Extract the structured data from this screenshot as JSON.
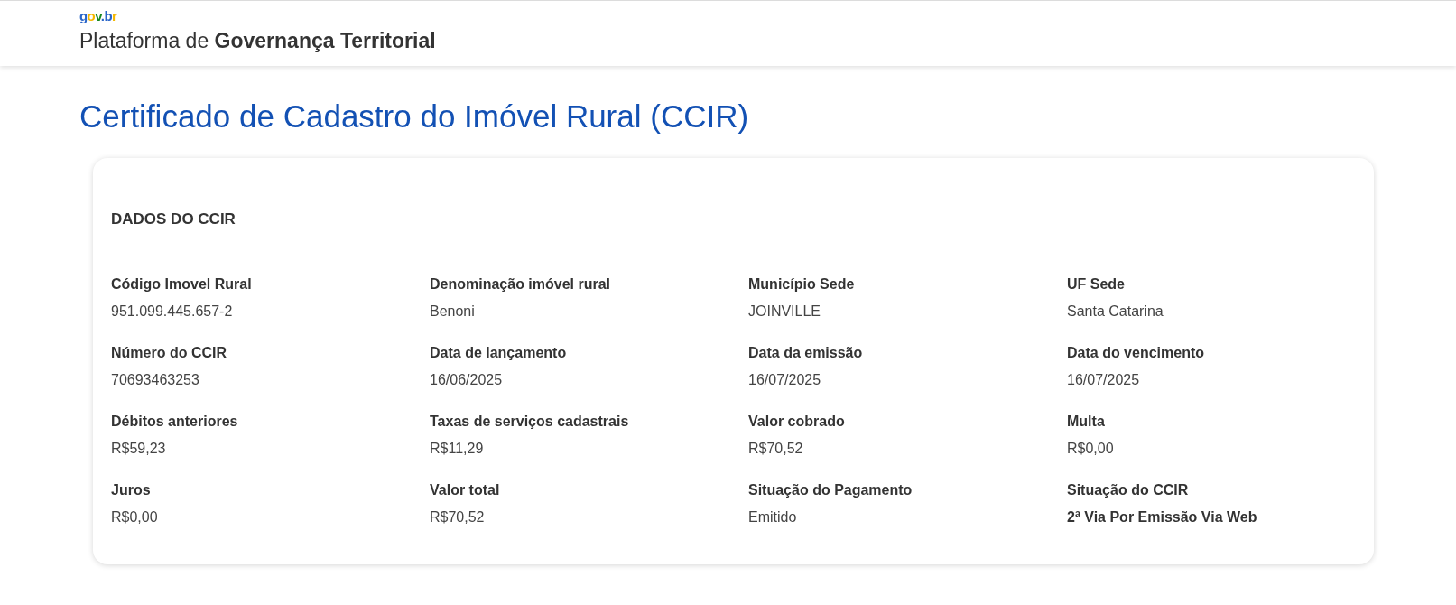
{
  "header": {
    "logo": "gov.br",
    "title": "Plataforma de **Governança Territorial**"
  },
  "page_title": "Certificado de Cadastro do Imóvel Rural (CCIR)",
  "card": {
    "title": "DADOS DO CCIR",
    "fields": [
      {
        "label": "Código Imovel Rural",
        "value": "951.099.445.657-2",
        "strong": false
      },
      {
        "label": "Denominação imóvel rural",
        "value": "Benoni",
        "strong": false
      },
      {
        "label": "Município Sede",
        "value": "JOINVILLE",
        "strong": false
      },
      {
        "label": "UF Sede",
        "value": "Santa Catarina",
        "strong": false
      },
      {
        "label": "Número do CCIR",
        "value": "70693463253",
        "strong": false
      },
      {
        "label": "Data de lançamento",
        "value": "16/06/2025",
        "strong": false
      },
      {
        "label": "Data da emissão",
        "value": "16/07/2025",
        "strong": false
      },
      {
        "label": "Data do vencimento",
        "value": "16/07/2025",
        "strong": false
      },
      {
        "label": "Débitos anteriores",
        "value": "R$59,23",
        "strong": false
      },
      {
        "label": "Taxas de serviços cadastrais",
        "value": "R$11,29",
        "strong": false
      },
      {
        "label": "Valor cobrado",
        "value": "R$70,52",
        "strong": false
      },
      {
        "label": "Multa",
        "value": "R$0,00",
        "strong": false
      },
      {
        "label": "Juros",
        "value": "R$0,00",
        "strong": false
      },
      {
        "label": "Valor total",
        "value": "R$70,52",
        "strong": false
      },
      {
        "label": "Situação do Pagamento",
        "value": "Emitido",
        "strong": false
      },
      {
        "label": "Situação do CCIR",
        "value": "2ª Via Por Emissão Via Web",
        "strong": true
      }
    ]
  }
}
